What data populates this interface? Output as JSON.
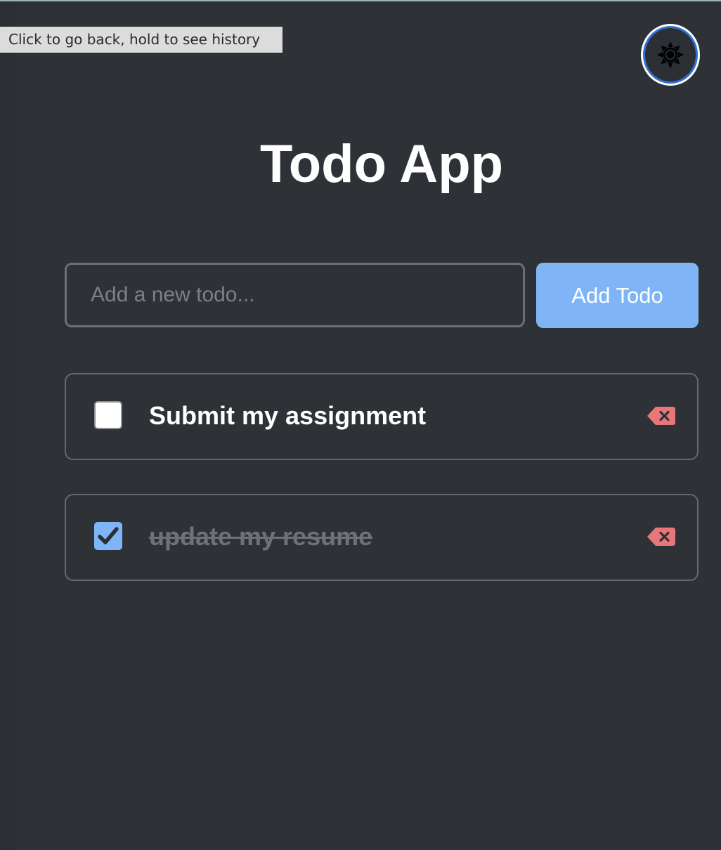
{
  "tooltip": {
    "text": "Click to go back, hold to see history"
  },
  "header": {
    "title": "Todo App",
    "theme_toggle_icon": "sun-icon"
  },
  "form": {
    "placeholder": "Add a new todo...",
    "value": "",
    "add_label": "Add Todo"
  },
  "todos": [
    {
      "text": "Submit my assignment",
      "completed": false
    },
    {
      "text": "update my resume",
      "completed": true
    }
  ],
  "colors": {
    "background": "#2e3236",
    "accent": "#7fb5f7",
    "delete": "#e8777a",
    "completed_text": "#6c7276"
  }
}
